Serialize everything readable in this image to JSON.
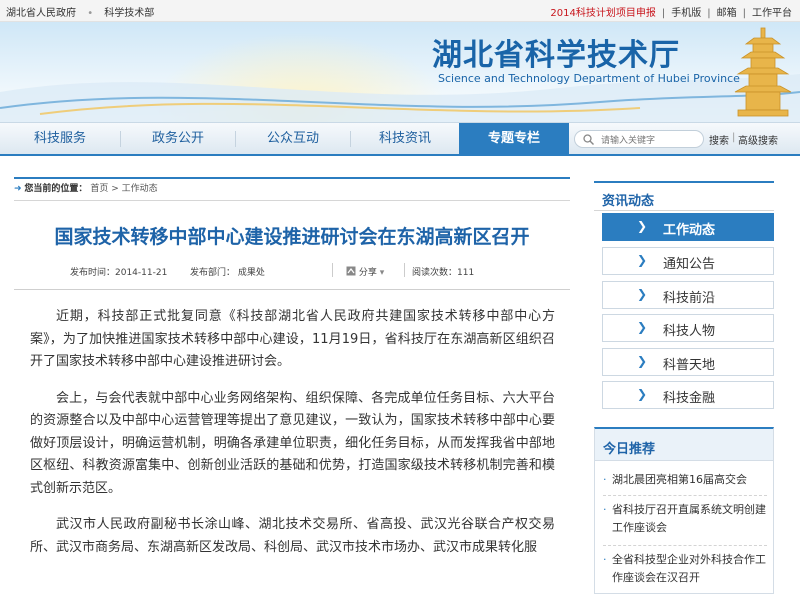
{
  "topbar": {
    "left_links": [
      "湖北省人民政府",
      "科学技术部"
    ],
    "right_highlight": "2014科技计划项目申报",
    "right_links": [
      "手机版",
      "邮箱",
      "工作平台"
    ]
  },
  "banner": {
    "title": "湖北省科学技术厅",
    "subtitle": "Science and Technology Department of Hubei Province"
  },
  "nav": {
    "items": [
      "科技服务",
      "政务公开",
      "公众互动",
      "科技资讯",
      "专题专栏"
    ],
    "active_index": 4,
    "search_placeholder": "请输入关键字",
    "search_button": "搜索",
    "advanced_search_button": "高级搜索"
  },
  "breadcrumb": {
    "label": "您当前的位置：",
    "home": "首页",
    "separator": ">",
    "current": "工作动态"
  },
  "article": {
    "title": "国家技术转移中部中心建设推进研讨会在东湖高新区召开",
    "publish_time": "发布时间：2014-11-21",
    "department": "发布部门： 成果处",
    "share": "分享",
    "visits": "阅读次数：111",
    "paragraphs": [
      "近期，科技部正式批复同意《科技部湖北省人民政府共建国家技术转移中部中心方案》，为了加快推进国家技术转移中部中心建设，11月19日，省科技厅在东湖高新区组织召开了国家技术转移中部中心建设推进研讨会。",
      "会上，与会代表就中部中心业务网络架构、组织保障、各完成单位任务目标、六大平台的资源整合以及中部中心运营管理等提出了意见建议，一致认为，国家技术转移中部中心要做好顶层设计，明确运营机制，明确各承建单位职责，细化任务目标，从而发挥我省中部地区枢纽、科教资源富集中、创新创业活跃的基础和优势，打造国家级技术转移机制完善和模式创新示范区。",
      "武汉市人民政府副秘书长涂山峰、湖北技术交易所、省高投、武汉光谷联合产权交易所、武汉市商务局、东湖高新区发改局、科创局、武汉市技术市场办、武汉市成果转化服"
    ]
  },
  "sidebar": {
    "section_title": "资讯动态",
    "items": [
      "工作动态",
      "通知公告",
      "科技前沿",
      "科技人物",
      "科普天地",
      "科技金融"
    ],
    "active_index": 0
  },
  "recommend": {
    "title": "今日推荐",
    "items": [
      "湖北晨团亮相第16届高交会",
      "省科技厅召开直属系统文明创建工作座谈会",
      "全省科技型企业对外科技合作工作座谈会在汉召开"
    ]
  },
  "colors": {
    "primary_blue": "#2b7dc0",
    "title_blue": "#1e63a8",
    "highlight_red": "#c8161d"
  }
}
